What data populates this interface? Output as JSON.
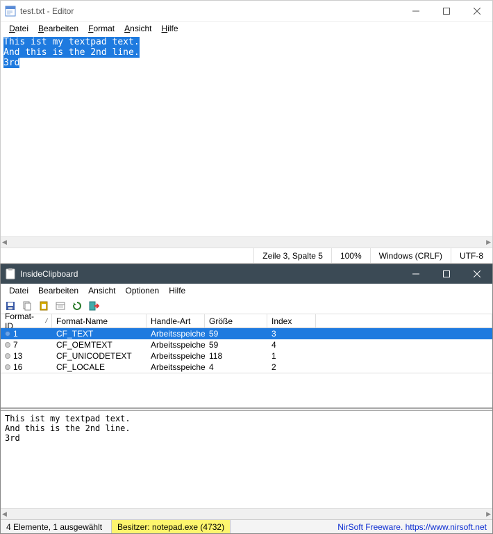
{
  "editor": {
    "title": "test.txt - Editor",
    "menus": {
      "file": "Datei",
      "edit": "Bearbeiten",
      "format": "Format",
      "view": "Ansicht",
      "help": "Hilfe"
    },
    "text_lines": [
      "This ist my textpad text.",
      "And this is the 2nd line.",
      "3rd"
    ],
    "status": {
      "caret": "Zeile 3, Spalte 5",
      "zoom": "100%",
      "eol": "Windows (CRLF)",
      "encoding": "UTF-8"
    }
  },
  "ic": {
    "title": "InsideClipboard",
    "menus": {
      "file": "Datei",
      "edit": "Bearbeiten",
      "view": "Ansicht",
      "options": "Optionen",
      "help": "Hilfe"
    },
    "headers": {
      "id": "Format-ID",
      "name": "Format-Name",
      "handle": "Handle-Art",
      "size": "Größe",
      "index": "Index"
    },
    "rows": [
      {
        "id": "1",
        "name": "CF_TEXT",
        "handle": "Arbeitsspeicher",
        "size": "59",
        "index": "3",
        "selected": true,
        "primary": true
      },
      {
        "id": "7",
        "name": "CF_OEMTEXT",
        "handle": "Arbeitsspeicher",
        "size": "59",
        "index": "4",
        "selected": false,
        "primary": false
      },
      {
        "id": "13",
        "name": "CF_UNICODETEXT",
        "handle": "Arbeitsspeicher",
        "size": "118",
        "index": "1",
        "selected": false,
        "primary": false
      },
      {
        "id": "16",
        "name": "CF_LOCALE",
        "handle": "Arbeitsspeicher",
        "size": "4",
        "index": "2",
        "selected": false,
        "primary": false
      }
    ],
    "preview_lines": [
      "This ist my textpad text.",
      "And this is the 2nd line.",
      "3rd"
    ],
    "status": {
      "count": "4 Elemente, 1 ausgewählt",
      "owner": "Besitzer: notepad.exe (4732)",
      "link": "NirSoft Freeware. https://www.nirsoft.net"
    }
  }
}
